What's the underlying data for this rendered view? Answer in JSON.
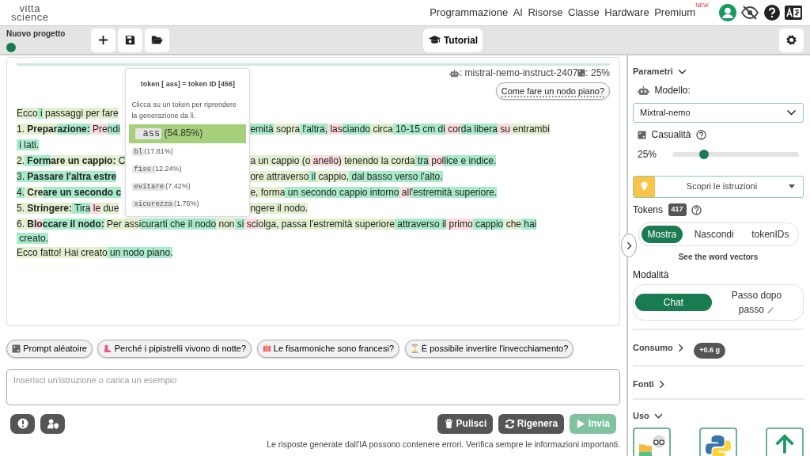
{
  "logo": {
    "line1": "vitta",
    "line2": "science"
  },
  "nav": [
    {
      "label": "Programmazione"
    },
    {
      "label": "AI"
    },
    {
      "label": "Risorse"
    },
    {
      "label": "Classe"
    },
    {
      "label": "Hardware"
    },
    {
      "label": "Premium",
      "badge": "NEW"
    }
  ],
  "toolbar": {
    "project": "Nuovo progetto",
    "tutorial": "Tutorial"
  },
  "chat": {
    "model_info": ": mistral-nemo-instruct-2407",
    "temperature_info": ": 25%",
    "user_message": "Come fare un nodo piano?",
    "lines": [
      {
        "left": [
          {
            "text": "Ecco",
            "color": "#e2f0cf"
          },
          {
            "text": " i",
            "color": "#a8ebcb"
          },
          {
            "text": " passaggi per fare",
            "color": "#e2f0cf"
          }
        ]
      },
      {
        "left": [
          {
            "text": "1.",
            "color": "#e2f0cf"
          },
          {
            "text": " **Prepar**",
            "color": "#e2f0cf"
          },
          {
            "text": "**azione:**",
            "color": "#a8ebcb"
          },
          {
            "text": " Pre",
            "color": "#fbdcdc"
          },
          {
            "text": "ndi",
            "color": "#a8ebcb"
          }
        ],
        "right": [
          {
            "text": "emità",
            "color": "#a8ebcb"
          },
          {
            "text": " sopra",
            "color": "#e2f0cf"
          },
          {
            "text": " l'altra,",
            "color": "#a8ebcb"
          },
          {
            "text": " las",
            "color": "#fbdcdc"
          },
          {
            "text": "ciando",
            "color": "#a8ebcb"
          },
          {
            "text": " circa",
            "color": "#e2f0cf"
          },
          {
            "text": " 10-15 cm di",
            "color": "#a8ebcb"
          },
          {
            "text": " cor",
            "color": "#fbdcdc"
          },
          {
            "text": "da libera",
            "color": "#a8ebcb"
          },
          {
            "text": " su",
            "color": "#fbdcdc"
          },
          {
            "text": " entrambi",
            "color": "#e2f0cf"
          }
        ]
      },
      {
        "left": [
          {
            "text": " i lati.",
            "color": "#a8ebcb"
          }
        ]
      },
      {
        "left": [
          {
            "text": "2.",
            "color": "#e2f0cf"
          },
          {
            "text": " **Form**",
            "color": "#a8ebcb"
          },
          {
            "text": "**are un cappio:**",
            "color": "#e2f0cf"
          },
          {
            "text": " C",
            "color": "#e2f0cf"
          }
        ],
        "right": [
          {
            "text": "a un cappio",
            "color": "#e2f0cf"
          },
          {
            "text": " (o",
            "color": "#e2f0cf"
          },
          {
            "text": " anello)",
            "color": "#fbdcdc"
          },
          {
            "text": " tenendo la corda",
            "color": "#e2f0cf"
          },
          {
            "text": " tra",
            "color": "#a8ebcb"
          },
          {
            "text": " pol",
            "color": "#fbdcdc"
          },
          {
            "text": "lice e indice.",
            "color": "#a8ebcb"
          }
        ]
      },
      {
        "left": [
          {
            "text": "3.",
            "color": "#a8ebcb"
          },
          {
            "text": " **Passare l'altra estre**",
            "color": "#a8ebcb"
          }
        ],
        "right": [
          {
            "text": "ore attraverso",
            "color": "#e2f0cf"
          },
          {
            "text": " il",
            "color": "#a8ebcb"
          },
          {
            "text": " cappio,",
            "color": "#e2f0cf"
          },
          {
            "text": " dal",
            "color": "#a8ebcb"
          },
          {
            "text": " basso verso l'alto.",
            "color": "#a8ebcb"
          }
        ]
      },
      {
        "left": [
          {
            "text": "4.",
            "color": "#a8ebcb"
          },
          {
            "text": " **Cre**",
            "color": "#e2f0cf"
          },
          {
            "text": "**are un secondo c**",
            "color": "#a8ebcb"
          }
        ],
        "right": [
          {
            "text": "e, forma",
            "color": "#e2f0cf"
          },
          {
            "text": " un secondo",
            "color": "#a8ebcb"
          },
          {
            "text": " cappio intorno",
            "color": "#a8ebcb"
          },
          {
            "text": " all",
            "color": "#fbdcdc"
          },
          {
            "text": "'estremità superiore.",
            "color": "#a8ebcb"
          }
        ]
      },
      {
        "left": [
          {
            "text": "5.",
            "color": "#e2f0cf"
          },
          {
            "text": " **Stringere:**",
            "color": "#e2f0cf"
          },
          {
            "text": " Tira",
            "color": "#a8ebcb"
          },
          {
            "text": " le",
            "color": "#fbdcdc"
          },
          {
            "text": " due",
            "color": "#e2f0cf"
          }
        ],
        "right": [
          {
            "text": "ngere il nodo.",
            "color": "#e2f0cf"
          }
        ]
      },
      {
        "left": [
          {
            "text": "6.",
            "color": "#e2f0cf"
          },
          {
            "text": " **B**",
            "color": "#e2f0cf"
          },
          {
            "text": "**lo**",
            "color": "#fbdcdc"
          },
          {
            "text": "**ccare il nodo:**",
            "color": "#a8ebcb"
          },
          {
            "text": " Per assi",
            "color": "#e2f0cf"
          },
          {
            "text": "curarti che il nodo",
            "color": "#a8ebcb"
          },
          {
            "text": " non",
            "color": "#e2f0cf"
          },
          {
            "text": " si",
            "color": "#a8ebcb"
          },
          {
            "text": " sci",
            "color": "#fbdcdc"
          },
          {
            "text": "olga, passa l'estremità superiore",
            "color": "#e2f0cf"
          },
          {
            "text": " attraverso il",
            "color": "#a8ebcb"
          },
          {
            "text": " primo",
            "color": "#fbdcdc"
          },
          {
            "text": " cappio",
            "color": "#a8ebcb"
          },
          {
            "text": " che",
            "color": "#e2f0cf"
          },
          {
            "text": " hai",
            "color": "#a8ebcb"
          }
        ]
      },
      {
        "left": [
          {
            "text": " creato.",
            "color": "#a8ebcb"
          }
        ]
      },
      {
        "left": [
          {
            "text": "Ecco fatto! Hai creato",
            "color": "#e2f0cf"
          },
          {
            "text": " un nodo piano.",
            "color": "#a8ebcb"
          }
        ]
      }
    ]
  },
  "token_popup": {
    "title": "token [ ass] = token ID [456]",
    "hint": "Clicca su un token per riprendere la generazione da lì.",
    "options": [
      {
        "token": " ass",
        "probability": "(54.85%)",
        "selected": true
      },
      {
        "token": "bl",
        "probability": "(17.81%)",
        "selected": false
      },
      {
        "token": "fiss",
        "probability": "(12.24%)",
        "selected": false
      },
      {
        "token": "evitare",
        "probability": "(7.42%)",
        "selected": false
      },
      {
        "token": "sicurezza",
        "probability": "(1.76%)",
        "selected": false
      }
    ]
  },
  "suggestions": [
    {
      "label": "Prompt aléatoire",
      "kind": "dice"
    },
    {
      "label": "Perché i pipistrelli vivono di notte?",
      "kind": "boot"
    },
    {
      "label": "Le fisarmoniche sono francesi?",
      "kind": "accordion"
    },
    {
      "label": "È possibile invertire l'invecchiamento?",
      "kind": "hourglass"
    }
  ],
  "input": {
    "placeholder": "Inserisci un'istruzione o carica un esempio"
  },
  "actions": [
    {
      "label": "Pulisci",
      "kind": "clear",
      "disabled": false
    },
    {
      "label": "Rigenera",
      "kind": "regenerate",
      "disabled": false
    },
    {
      "label": "Invia",
      "kind": "send",
      "disabled": true
    }
  ],
  "disclaimer": "Le risposte generate dall'IA possono contenere errori. Verifica sempre le informazioni importanti.",
  "sidebar": {
    "parameters": {
      "title": "Parametri",
      "expanded": true
    },
    "model_label": "Modello:",
    "model": "Mixtral-nemo",
    "randomness_label": "Casualità",
    "randomness_value": "25%",
    "randomness": {
      "level": 0.25
    },
    "instructions": "Scopri le istruzioni",
    "tokens_label": "Tokens",
    "tokens_count": "417",
    "token_view": [
      {
        "label": "Mostra",
        "selected": true
      },
      {
        "label": "Nascondi",
        "selected": false
      },
      {
        "label": "tokenIDs",
        "selected": false
      }
    ],
    "vectors_link": "See the word vectors",
    "mode_label": "Modalità",
    "modes": [
      {
        "label": "Chat",
        "selected": true
      },
      {
        "label": "Passo dopo passo",
        "selected": false
      }
    ],
    "consumption": {
      "title": "Consumo",
      "expanded": false,
      "value": "+0.6 g"
    },
    "sources": {
      "title": "Fonti",
      "expanded": false
    },
    "usage": {
      "title": "Uso",
      "expanded": true
    }
  }
}
